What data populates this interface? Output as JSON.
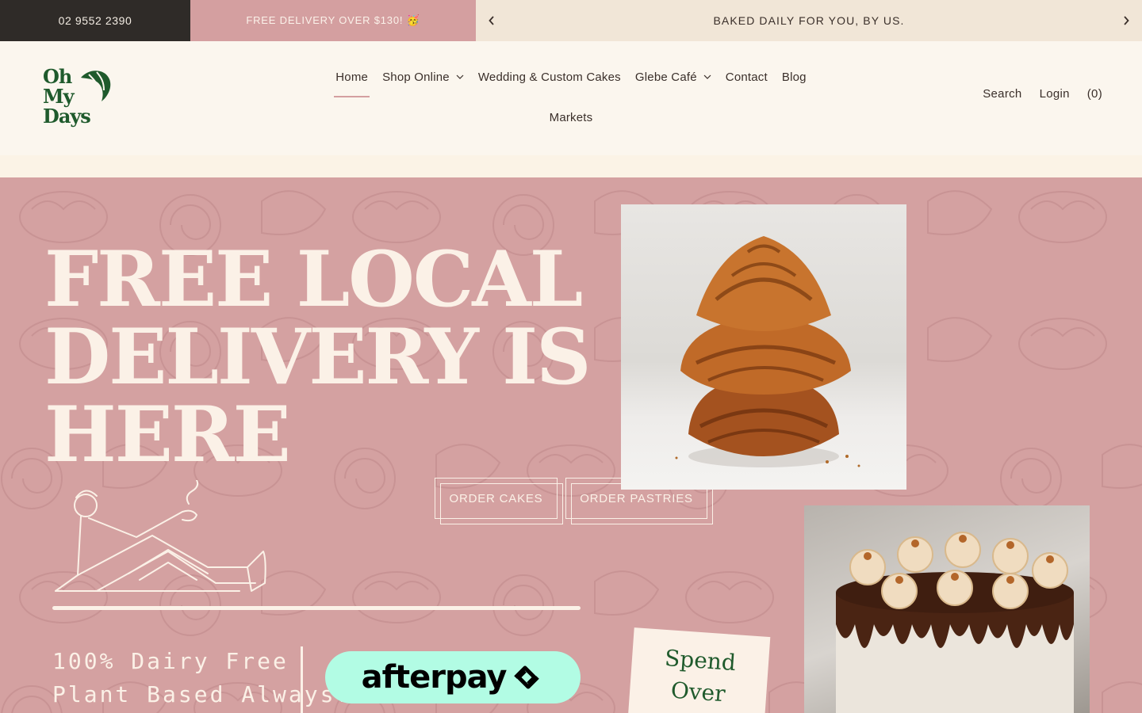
{
  "announcement": {
    "phone": "02 9552 2390",
    "delivery": "FREE DELIVERY OVER $130! 🥳",
    "rotating_message": "BAKED DAILY FOR YOU, BY US.",
    "prev_icon": "chevron-left-icon",
    "next_icon": "chevron-right-icon"
  },
  "header": {
    "logo_text": [
      "Oh",
      "My",
      "Days"
    ],
    "nav": [
      {
        "label": "Home",
        "active": true
      },
      {
        "label": "Shop Online",
        "dropdown": true
      },
      {
        "label": "Wedding & Custom Cakes"
      },
      {
        "label": "Glebe Café",
        "dropdown": true
      },
      {
        "label": "Contact"
      },
      {
        "label": "Blog"
      }
    ],
    "nav_second_row": [
      {
        "label": "Markets"
      }
    ],
    "search_label": "Search",
    "login_label": "Login",
    "cart_label": "(0)"
  },
  "hero": {
    "title_lines": [
      "FREE LOCAL",
      "DELIVERY IS",
      "HERE"
    ],
    "dairy_lines": [
      "100% Dairy Free",
      "Plant Based Always."
    ],
    "afterpay_label": "afterpay",
    "order_cakes_label": "ORDER CAKES",
    "order_pastries_label": "ORDER PASTRIES",
    "spend_lines": [
      "Spend",
      "Over"
    ]
  },
  "colors": {
    "brand_green": "#1f5a2c",
    "hero_pink": "#d4a1a1",
    "cream": "#fbf1e7",
    "dark_bar": "#2f2b28",
    "afterpay_mint": "#b2fce4"
  }
}
